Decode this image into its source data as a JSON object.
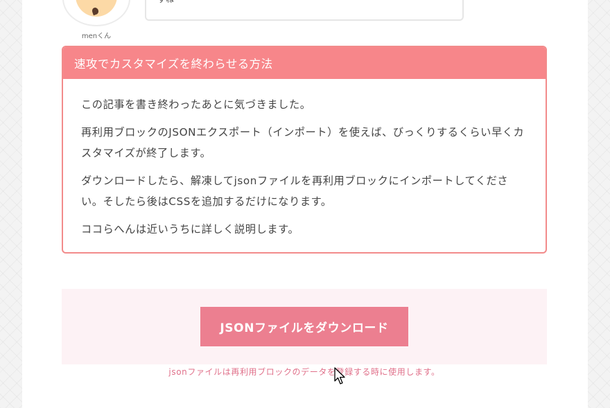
{
  "avatar": {
    "name": "menくん",
    "icon": "character-avatar"
  },
  "bubble": {
    "text": "すね"
  },
  "callout": {
    "title": "速攻でカスタマイズを終わらせる方法",
    "paragraphs": [
      "この記事を書き終わったあとに気づきました。",
      "再利用ブロックのJSONエクスポート（インポート）を使えば、びっくりするくらい早くカスタマイズが終了します。",
      "ダウンロードしたら、解凍してjsonファイルを再利用ブロックにインポートしてください。そしたら後はCSSを追加するだけになります。",
      "ココらへんは近いうちに詳しく説明します。"
    ],
    "border_color": "#f28b8b",
    "header_color": "#f7868a"
  },
  "download": {
    "button_label": "JSONファイルをダウンロード",
    "note": "jsonファイルは再利用ブロックのデータを登録する時に使用します。",
    "button_color": "#ec7f90",
    "section_bg": "#fdf2f5"
  },
  "cursor": {
    "icon": "mouse-pointer-icon"
  }
}
